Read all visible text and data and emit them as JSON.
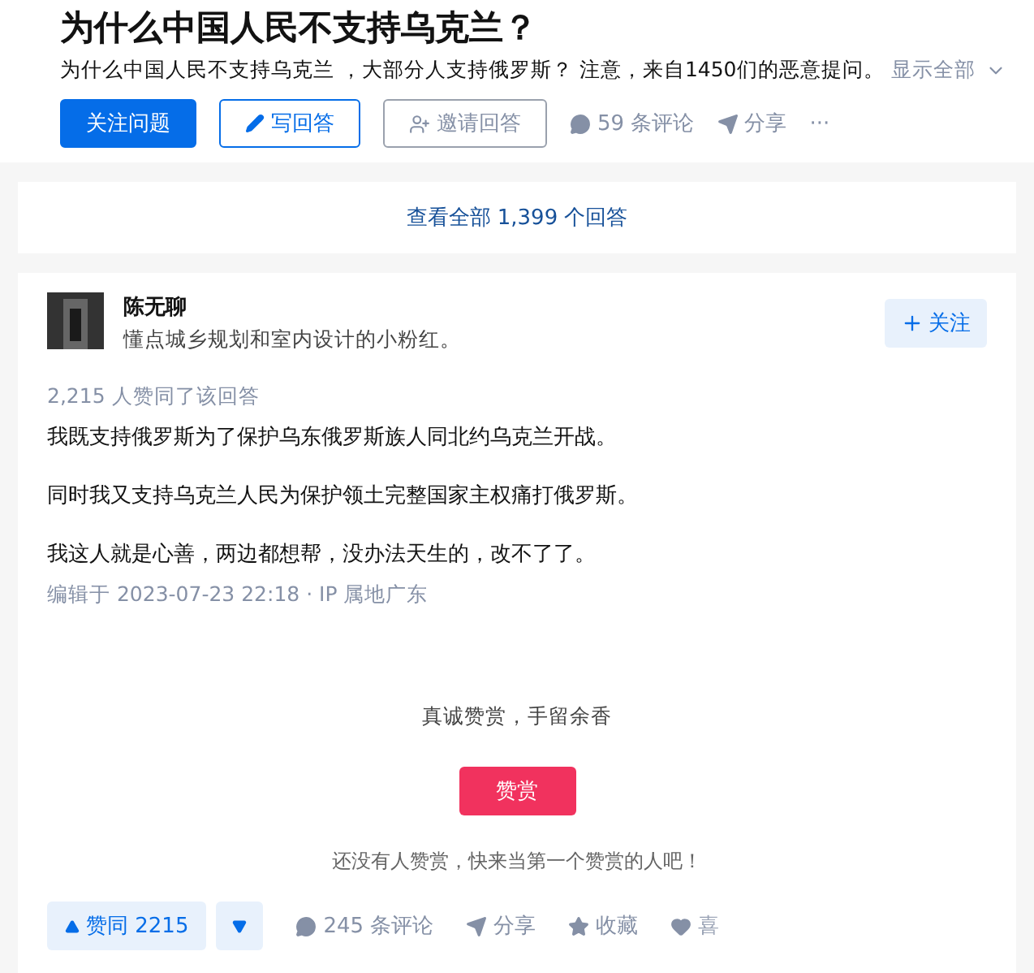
{
  "question": {
    "title": "为什么中国人民不支持乌克兰？",
    "detail": "为什么中国人民不支持乌克兰 ，大部分人支持俄罗斯？ 注意，来自1450们的恶意提问。",
    "expand": "显示全部"
  },
  "question_actions": [
    {
      "kind": "primary",
      "label": "关注问题"
    },
    {
      "kind": "outline",
      "label": "写回答"
    },
    {
      "kind": "invite",
      "label": "邀请回答"
    },
    {
      "kind": "comment",
      "label": "59 条评论"
    },
    {
      "kind": "share",
      "label": "分享"
    },
    {
      "kind": "more",
      "label": "···"
    }
  ],
  "view_all": "查看全部 1,399 个回答",
  "answer": {
    "author": "陈无聊",
    "bio": "懂点城乡规划和室内设计的小粉红。",
    "follow": "关注",
    "followed": false,
    "upvote_note": "2,215 人赞同了该回答",
    "paragraphs": [
      "我既支持俄罗斯为了保护乌东俄罗斯族人同北约乌克兰开战。",
      "同时我又支持乌克兰人民为保护领土完整国家主权痛打俄罗斯。",
      "我这人就是心善，两边都想帮，没办法天生的，改不了了。"
    ],
    "edited": "编辑于 2023-07-23 22:18 · IP 属地广东",
    "reward_slogan": "真诚赞赏，手留余香",
    "reward_button": "赞赏",
    "reward_note": "还没有人赞赏，快来当第一个赞赏的人吧！"
  },
  "answer_actions": [
    {
      "kind": "upvote",
      "label": "赞同 2215"
    },
    {
      "kind": "downvote"
    },
    {
      "kind": "comment",
      "label": "245 条评论"
    },
    {
      "kind": "share",
      "label": "分享"
    },
    {
      "kind": "star",
      "label": "收藏"
    },
    {
      "kind": "heart",
      "label": "喜"
    }
  ]
}
